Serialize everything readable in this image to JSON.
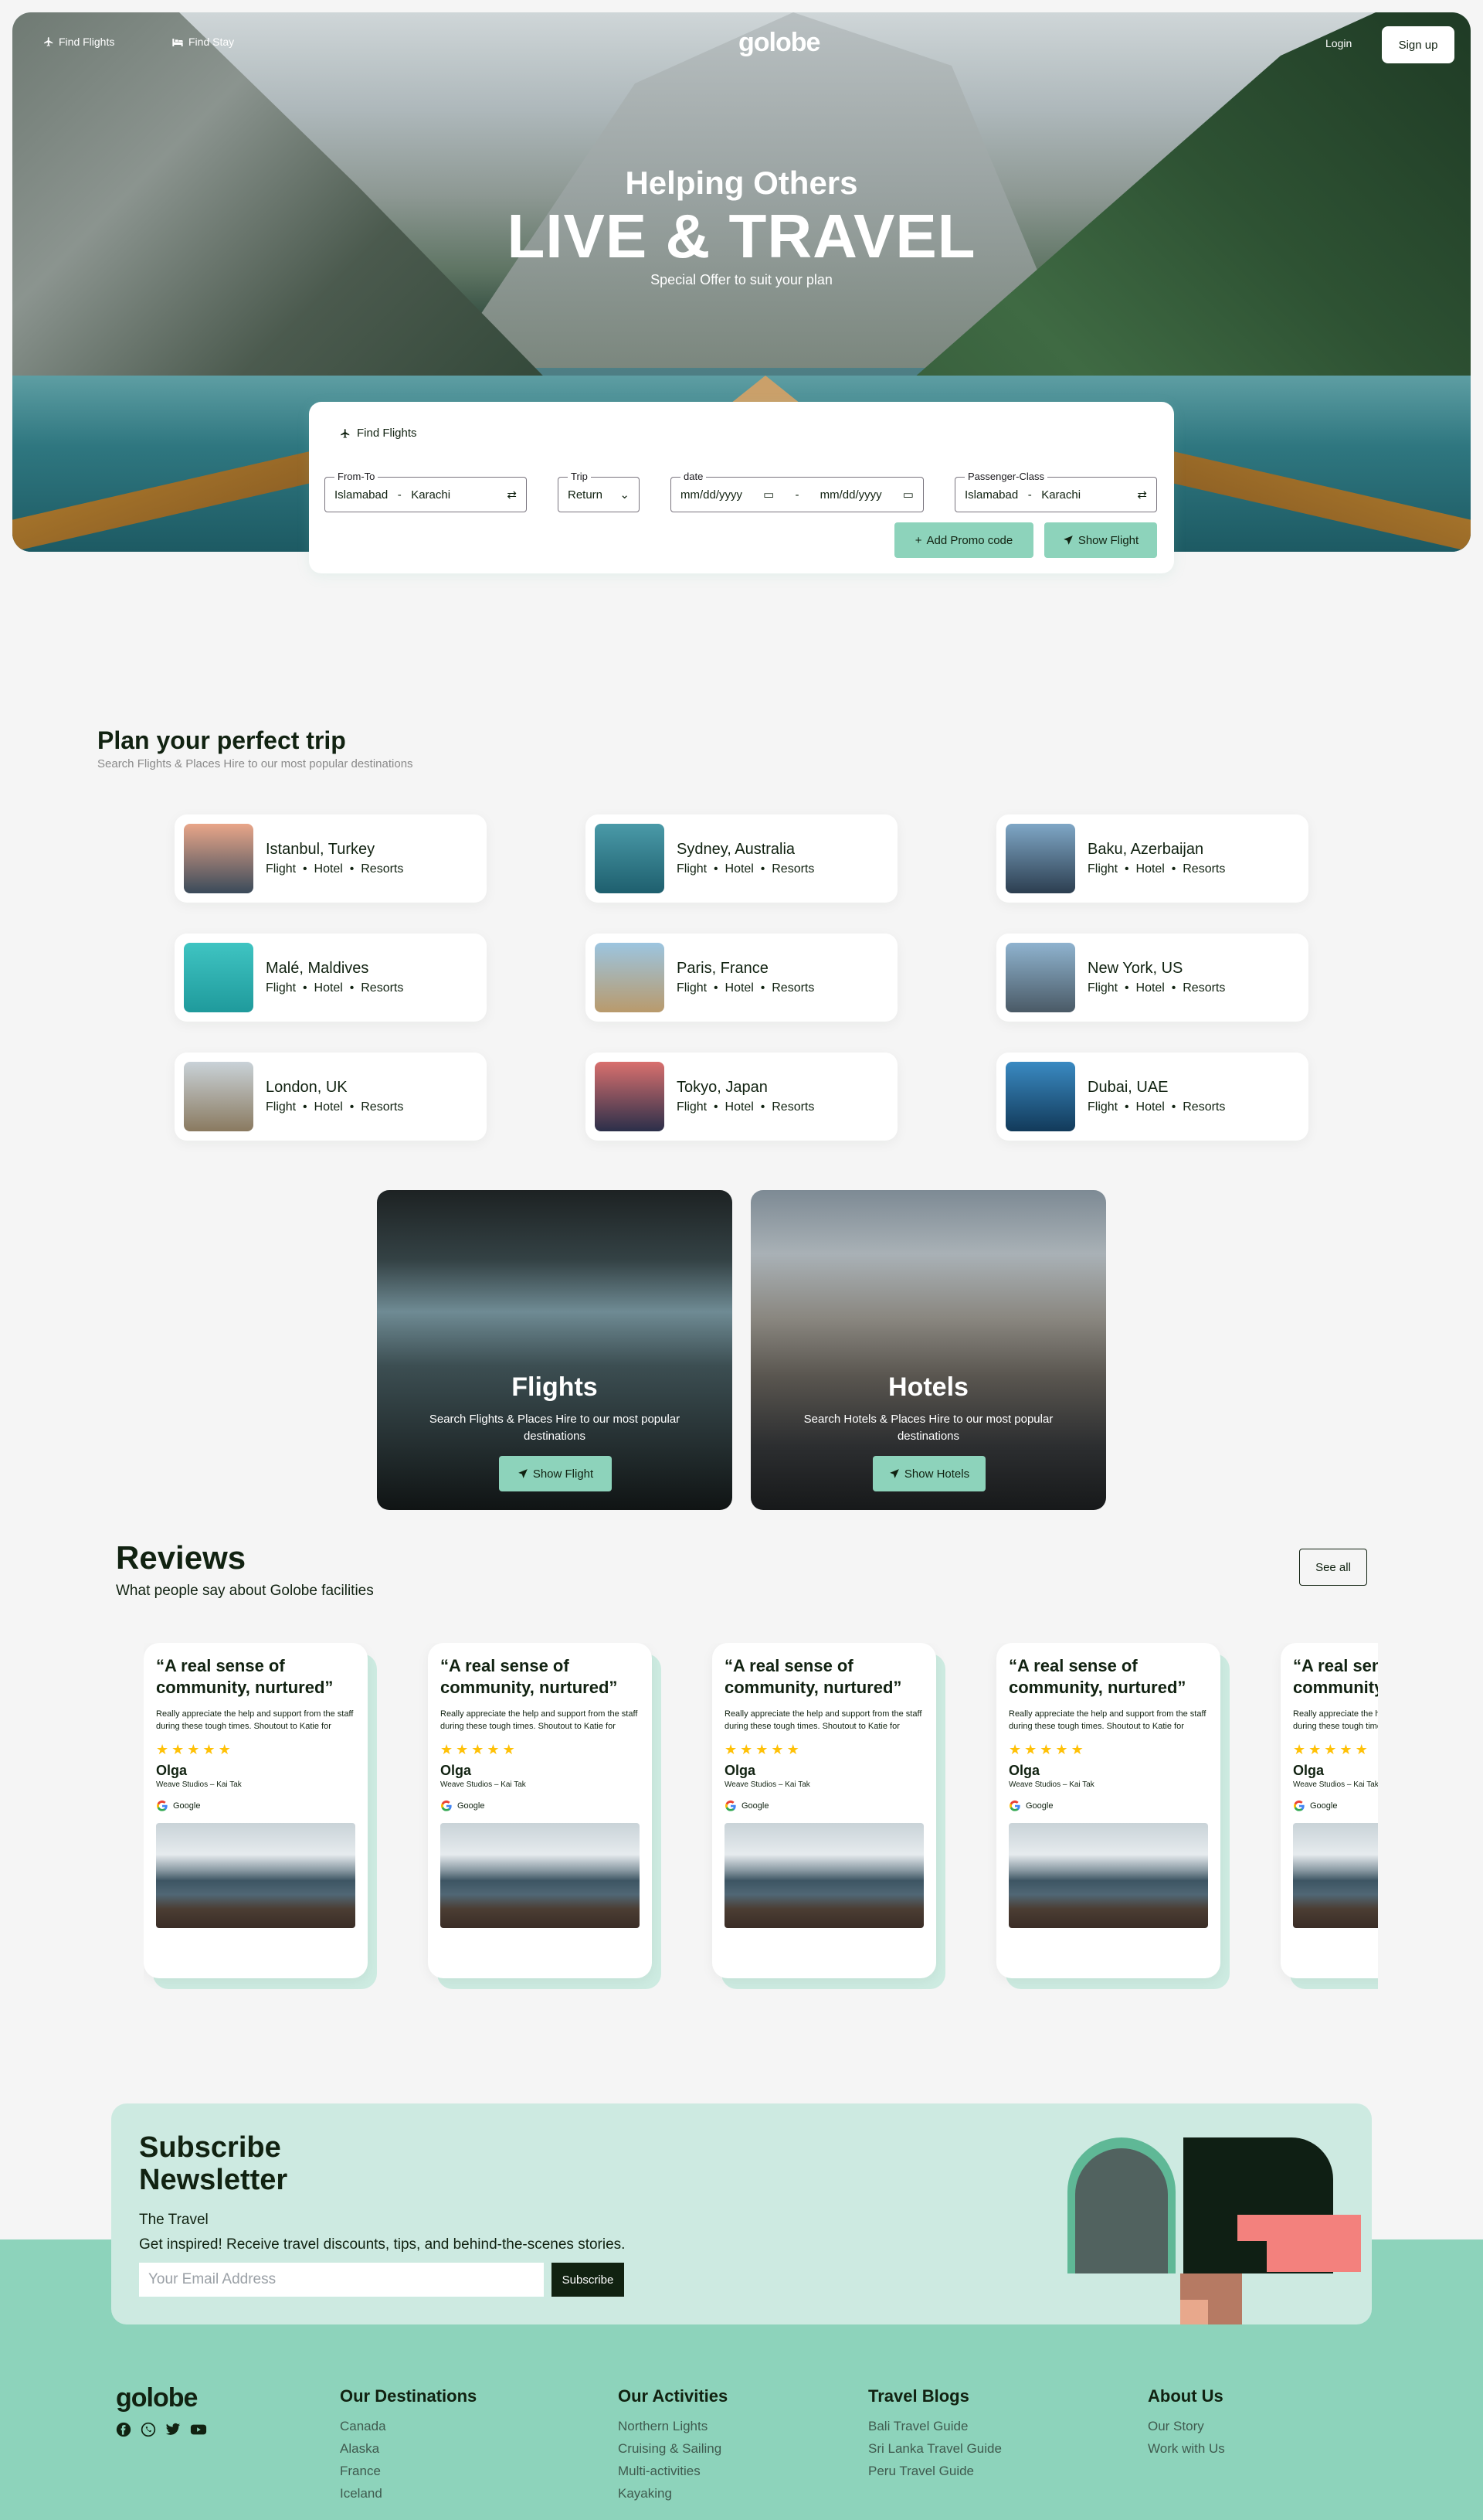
{
  "nav": {
    "find_flights": "Find Flights",
    "find_stay": "Find Stay",
    "logo": "golobe",
    "login": "Login",
    "signup": "Sign up"
  },
  "hero": {
    "title_small": "Helping Others",
    "title_big": "LIVE & TRAVEL",
    "subtitle": "Special Offer to suit your plan"
  },
  "search": {
    "tab_label": "Find Flights",
    "from_to_label": "From-To",
    "from_to_value": "Islamabad   -   Karachi",
    "trip_label": "Trip",
    "trip_value": "Return",
    "date_label": "date",
    "date_start_placeholder": "mm/dd/yyyy",
    "date_separator": "-",
    "date_end_placeholder": "mm/dd/yyyy",
    "passenger_label": "Passenger-Class",
    "passenger_value": "Islamabad   -   Karachi",
    "promo_button": "Add Promo code",
    "show_flight_button": "Show Flight"
  },
  "plan": {
    "title": "Plan your perfect trip",
    "subtitle": "Search Flights & Places Hire to our most popular destinations",
    "destinations": [
      {
        "name": "Istanbul, Turkey",
        "services": "Flight  •  Hotel  •  Resorts",
        "color_top": "#e9a689",
        "color_bottom": "#3a4a5a"
      },
      {
        "name": "Sydney, Australia",
        "services": "Flight  •  Hotel  •  Resorts",
        "color_top": "#4a9aa8",
        "color_bottom": "#1e5f6e"
      },
      {
        "name": "Baku, Azerbaijan",
        "services": "Flight  •  Hotel  •  Resorts",
        "color_top": "#7fa7c6",
        "color_bottom": "#2c3e50"
      },
      {
        "name": "Malé, Maldives",
        "services": "Flight  •  Hotel  •  Resorts",
        "color_top": "#3fc4c2",
        "color_bottom": "#1f9a9c"
      },
      {
        "name": "Paris, France",
        "services": "Flight  •  Hotel  •  Resorts",
        "color_top": "#9cc5e0",
        "color_bottom": "#b99a6c"
      },
      {
        "name": "New York, US",
        "services": "Flight  •  Hotel  •  Resorts",
        "color_top": "#8fb3cf",
        "color_bottom": "#4a5a66"
      },
      {
        "name": "London, UK",
        "services": "Flight  •  Hotel  •  Resorts",
        "color_top": "#c9d2d8",
        "color_bottom": "#8a7a60"
      },
      {
        "name": "Tokyo, Japan",
        "services": "Flight  •  Hotel  •  Resorts",
        "color_top": "#d9706e",
        "color_bottom": "#2b2f4a"
      },
      {
        "name": "Dubai, UAE",
        "services": "Flight  •  Hotel  •  Resorts",
        "color_top": "#3a8ac2",
        "color_bottom": "#123a5a"
      }
    ]
  },
  "promo": {
    "flights_title": "Flights",
    "flights_desc": "Search Flights & Places Hire to our most popular destinations",
    "flights_button": "Show Flight",
    "hotels_title": "Hotels",
    "hotels_desc": "Search Hotels & Places Hire to our most popular destinations",
    "hotels_button": "Show Hotels"
  },
  "reviews": {
    "title": "Reviews",
    "subtitle": "What people say about Golobe facilities",
    "see_all": "See all",
    "items": [
      {
        "quote": "“A real sense of community, nurtured”",
        "body": "Really appreciate the help and support from the staff during these tough times. Shoutout to Katie for",
        "stars": 5,
        "name": "Olga",
        "company": "Weave Studios – Kai Tak",
        "source": "Google"
      },
      {
        "quote": "“A real sense of community, nurtured”",
        "body": "Really appreciate the help and support from the staff during these tough times. Shoutout to Katie for",
        "stars": 5,
        "name": "Olga",
        "company": "Weave Studios – Kai Tak",
        "source": "Google"
      },
      {
        "quote": "“A real sense of community, nurtured”",
        "body": "Really appreciate the help and support from the staff during these tough times. Shoutout to Katie for",
        "stars": 5,
        "name": "Olga",
        "company": "Weave Studios – Kai Tak",
        "source": "Google"
      },
      {
        "quote": "“A real sense of community, nurtured”",
        "body": "Really appreciate the help and support from the staff during these tough times. Shoutout to Katie for",
        "stars": 5,
        "name": "Olga",
        "company": "Weave Studios – Kai Tak",
        "source": "Google"
      },
      {
        "quote": "“A real sense of community, nurtured”",
        "body": "Really appreciate the help and support from the staff during these tough times. Shoutout to Katie for",
        "stars": 5,
        "name": "Olga",
        "company": "Weave Studios – Kai Tak",
        "source": "Google"
      }
    ]
  },
  "newsletter": {
    "title_line1": "Subscribe",
    "title_line2": "Newsletter",
    "brand": "The Travel",
    "tagline": "Get inspired! Receive travel discounts, tips, and behind-the-scenes stories.",
    "email_placeholder": "Your Email Address",
    "subscribe_button": "Subscribe"
  },
  "footer": {
    "logo": "golobe",
    "social_icons": [
      "facebook-icon",
      "whatsapp-icon",
      "twitter-icon",
      "youtube-icon"
    ],
    "columns": [
      {
        "title": "Our Destinations",
        "items": [
          "Canada",
          "Alaska",
          "France",
          "Iceland"
        ]
      },
      {
        "title": "Our Activities",
        "items": [
          "Northern Lights",
          "Cruising & Sailing",
          "Multi-activities",
          "Kayaking"
        ]
      },
      {
        "title": "Travel Blogs",
        "items": [
          "Bali Travel Guide",
          "Sri Lanka Travel Guide",
          "Peru Travel Guide"
        ]
      },
      {
        "title": "About Us",
        "items": [
          "Our Story",
          "Work with Us"
        ]
      }
    ]
  },
  "colors": {
    "accent": "#8DD3BB",
    "dark": "#112211",
    "star": "#FFC107",
    "newsletter_bg": "#CDEAE1"
  }
}
